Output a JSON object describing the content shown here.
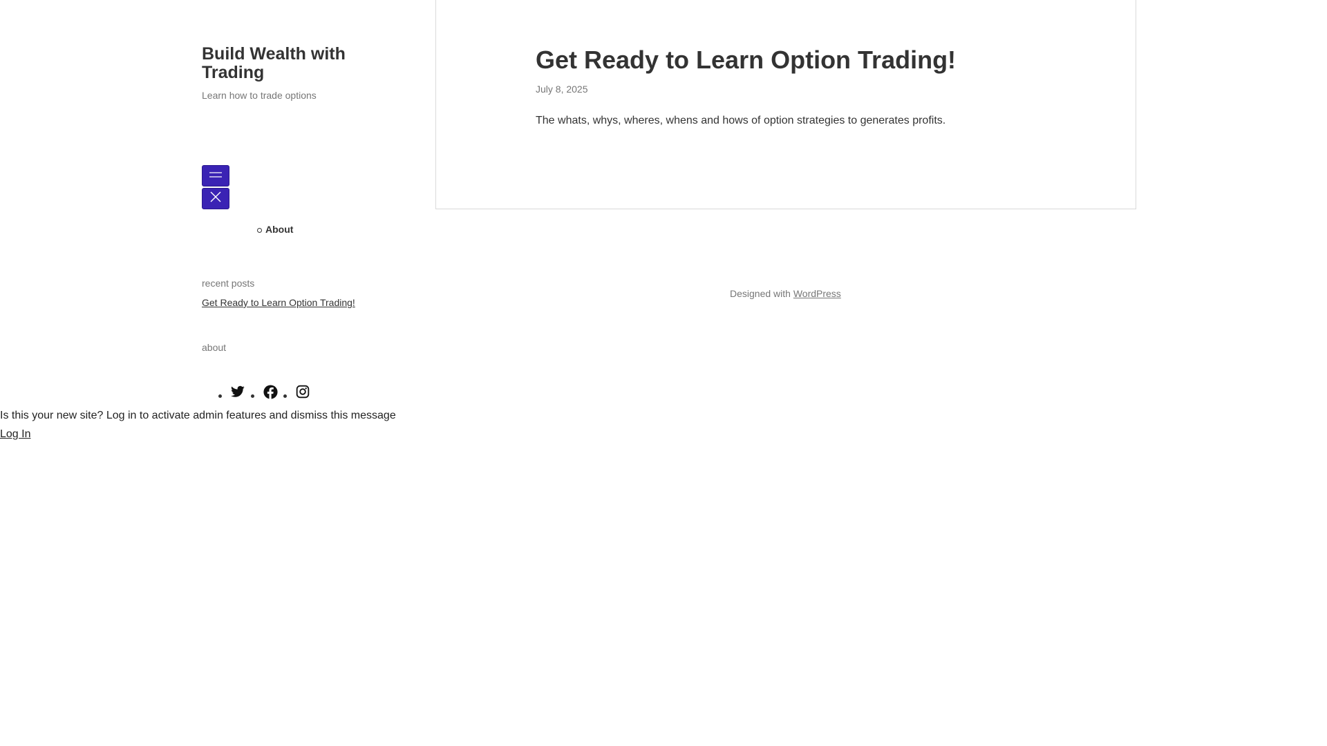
{
  "site": {
    "title": "Build Wealth with Trading",
    "tagline": "Learn how to trade options"
  },
  "nav": {
    "open_icon": "menu-icon",
    "close_icon": "close-icon",
    "items": [
      {
        "label": "About"
      }
    ]
  },
  "sidebar": {
    "recent_posts_heading": "recent posts",
    "recent_posts": [
      {
        "label": "Get Ready to Learn Option Trading!"
      }
    ],
    "about_heading": "about",
    "social": [
      {
        "icon": "twitter-icon"
      },
      {
        "icon": "facebook-icon"
      },
      {
        "icon": "instagram-icon"
      }
    ]
  },
  "post": {
    "title": "Get Ready to Learn Option Trading!",
    "date": "July 8, 2025",
    "excerpt": "The whats, whys, wheres, whens and hows of option strategies to generates profits."
  },
  "footer": {
    "credit_prefix": "Designed with",
    "credit_link": "WordPress"
  },
  "admin_notice": {
    "message": "Is this your new site? Log in to activate admin features and dismiss this message",
    "login_label": "Log In"
  },
  "colors": {
    "accent": "#3a23b4",
    "text": "#333333",
    "muted": "#767676",
    "border": "#d9d9d9"
  }
}
